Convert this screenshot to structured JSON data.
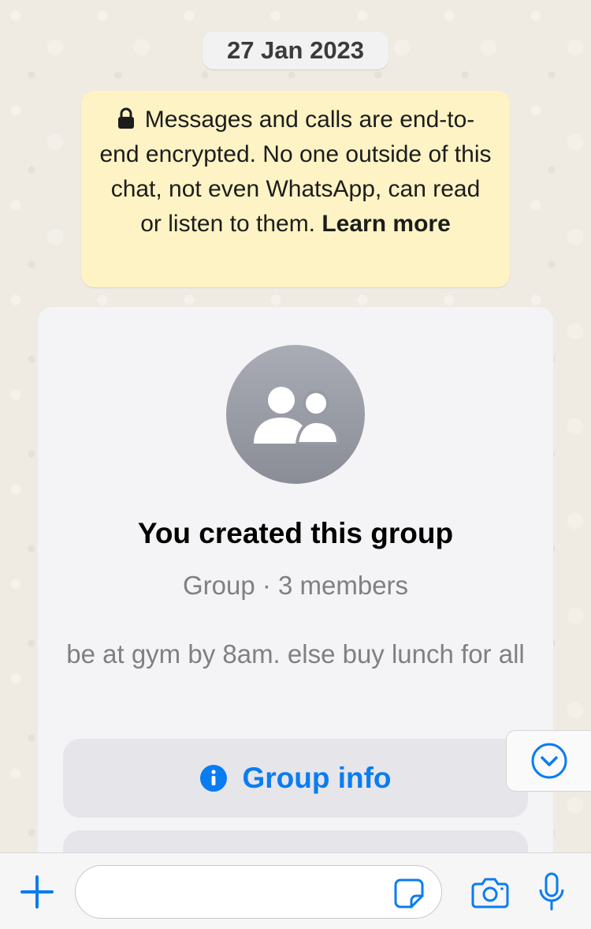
{
  "chat": {
    "date": "27 Jan 2023",
    "encryption_notice": "Messages and calls are end-to-end encrypted. No one outside of this chat, not even WhatsApp, can read or listen to them.",
    "learn_more": "Learn more"
  },
  "group": {
    "title": "You created this group",
    "subtitle": "Group · 3 members",
    "description": "be at gym by 8am. else buy lunch for all",
    "info_button": "Group info"
  },
  "input": {
    "placeholder": "",
    "value": ""
  },
  "colors": {
    "accent": "#0a7cf2",
    "encryption_bg": "#fdf3c4",
    "chat_bg": "#efeae2"
  },
  "icons": [
    "lock-icon",
    "group-avatar-icon",
    "info-icon",
    "scroll-down-icon",
    "plus-icon",
    "sticker-icon",
    "camera-icon",
    "microphone-icon"
  ]
}
